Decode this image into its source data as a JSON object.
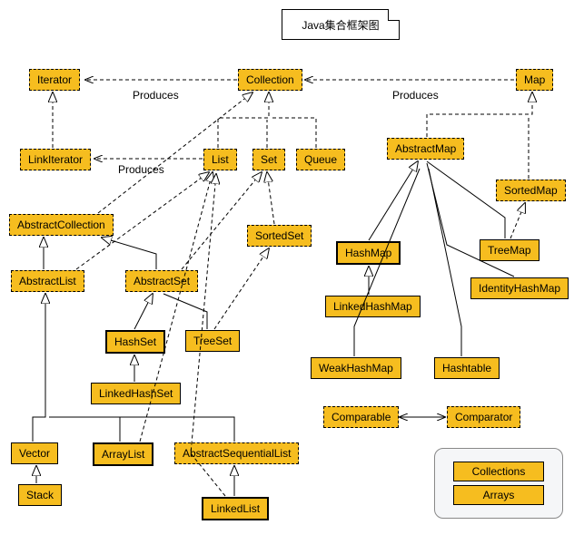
{
  "title": "Java集合框架图",
  "edge_labels": {
    "produces1": "Produces",
    "produces2": "Produces",
    "produces3": "Produces"
  },
  "nodes": {
    "iterator": "Iterator",
    "collection": "Collection",
    "map": "Map",
    "linkiterator": "LinkIterator",
    "list": "List",
    "set": "Set",
    "queue": "Queue",
    "abstractmap": "AbstractMap",
    "sortedmap": "SortedMap",
    "abstractcollection": "AbstractCollection",
    "sortedset": "SortedSet",
    "hashmap": "HashMap",
    "treemap": "TreeMap",
    "identityhashmap": "IdentityHashMap",
    "abstractlist": "AbstractList",
    "abstractset": "AbstractSet",
    "linkedhashmap": "LinkedHashMap",
    "hashset": "HashSet",
    "treeset": "TreeSet",
    "weakhashmap": "WeakHashMap",
    "hashtable": "Hashtable",
    "linkedhashset": "LinkedHashSet",
    "comparable": "Comparable",
    "comparator": "Comparator",
    "vector": "Vector",
    "arraylist": "ArrayList",
    "abstractsequentiallist": "AbstractSequentialList",
    "stack": "Stack",
    "linkedlist": "LinkedList",
    "collections": "Collections",
    "arrays": "Arrays"
  }
}
